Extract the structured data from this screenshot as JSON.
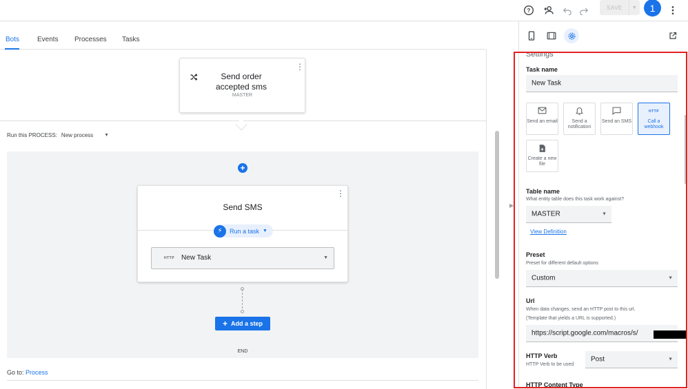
{
  "topbar": {
    "icons": [
      "help-icon",
      "add-person-icon",
      "undo-icon",
      "redo-icon",
      "more-vert-icon"
    ],
    "save_label": "SAVE",
    "avatar_initial": "1"
  },
  "tabs": [
    {
      "label": "Bots",
      "active": true
    },
    {
      "label": "Events",
      "active": false
    },
    {
      "label": "Processes",
      "active": false
    },
    {
      "label": "Tasks",
      "active": false
    }
  ],
  "event_card": {
    "title": "Send order accepted sms",
    "subtitle": "MASTER"
  },
  "run_process": {
    "label": "Run this PROCESS:",
    "value": "New process"
  },
  "step": {
    "title": "Send SMS",
    "action_label": "Run a task",
    "task_badge": "HTTP",
    "task_value": "New Task"
  },
  "add_step_label": "Add a step",
  "end_label": "END",
  "goto": {
    "label": "Go to:",
    "link": "Process"
  },
  "settings": {
    "heading": "Settings",
    "task_name_label": "Task name",
    "task_name_value": "New Task",
    "task_types": [
      {
        "label": "Send an email",
        "icon": "email-icon",
        "selected": false
      },
      {
        "label": "Send a notification",
        "icon": "bell-icon",
        "selected": false
      },
      {
        "label": "Send an SMS",
        "icon": "sms-icon",
        "selected": false
      },
      {
        "label": "Call a webhook",
        "icon": "HTTP",
        "selected": true
      },
      {
        "label": "Create a new file",
        "icon": "file-icon",
        "selected": false
      }
    ],
    "table_name_label": "Table name",
    "table_name_hint": "What entity table does this task work against?",
    "table_name_value": "MASTER",
    "view_definition": "View Definition",
    "preset_label": "Preset",
    "preset_hint": "Preset for different default options",
    "preset_value": "Custom",
    "url_label": "Url",
    "url_hint1": "When data changes, send an HTTP post to this url.",
    "url_hint2": "(Template that yields a URL is supported.)",
    "url_value": "https://script.google.com/macros/s/",
    "http_verb_label": "HTTP Verb",
    "http_verb_hint": "HTTP Verb to be used",
    "http_verb_value": "Post",
    "http_content_type_label": "HTTP Content Type"
  },
  "colors": {
    "accent": "#1a73e8",
    "highlight_frame": "#e32020"
  }
}
